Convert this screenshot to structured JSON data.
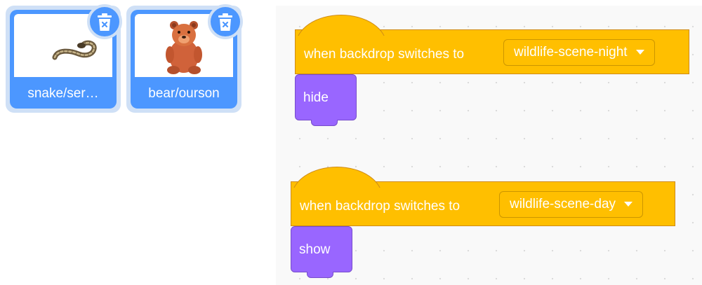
{
  "sprites": [
    {
      "name": "snake/ser…",
      "icon": "snake-image",
      "delete_icon": "trash-icon"
    },
    {
      "name": "bear/ourson",
      "icon": "bear-image",
      "delete_icon": "trash-icon"
    }
  ],
  "scripts": [
    {
      "hat_label": "when backdrop switches to",
      "dropdown_value": "wildlife-scene-night",
      "block_label": "hide"
    },
    {
      "hat_label": "when backdrop switches to",
      "dropdown_value": "wildlife-scene-day",
      "block_label": "show"
    }
  ],
  "colors": {
    "sprite_tile": "#4c97ff",
    "events_block": "#ffbf00",
    "looks_block": "#9966ff"
  }
}
